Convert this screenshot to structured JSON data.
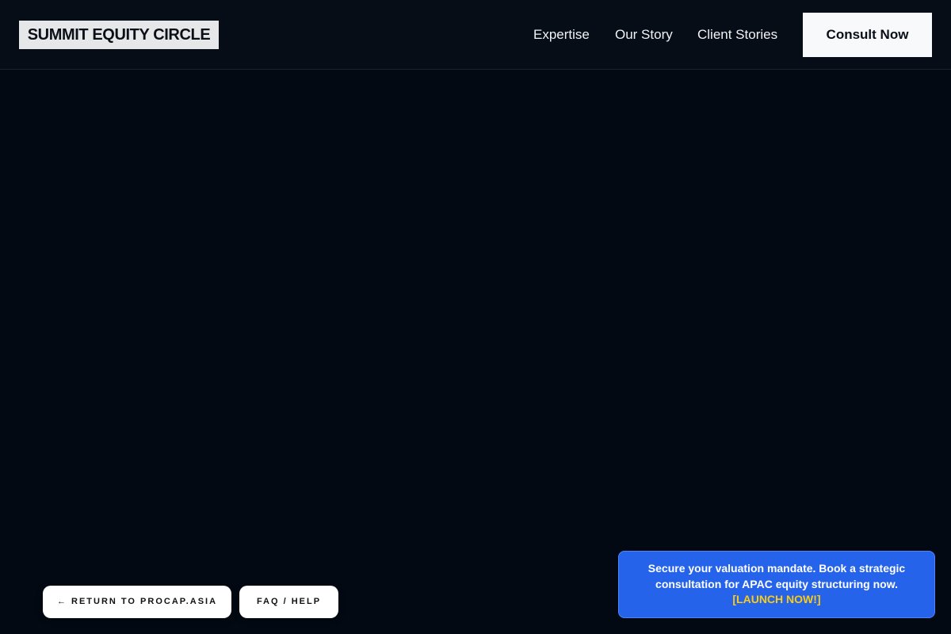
{
  "header": {
    "logo_text": "SUMMIT EQUITY CIRCLE",
    "nav": [
      {
        "label": "Expertise"
      },
      {
        "label": "Our Story"
      },
      {
        "label": "Client Stories"
      }
    ],
    "cta_label": "Consult Now"
  },
  "footer_buttons": {
    "return_label": "← RETURN TO PROCAP.ASIA",
    "faq_label": "FAQ / HELP"
  },
  "promo": {
    "message": "Secure your valuation mandate. Book a strategic consultation for APAC equity structuring now.",
    "link_label": "[LAUNCH NOW!]"
  },
  "colors": {
    "background": "#020912",
    "promo_blue": "#2563eb",
    "promo_link": "#facc15"
  }
}
